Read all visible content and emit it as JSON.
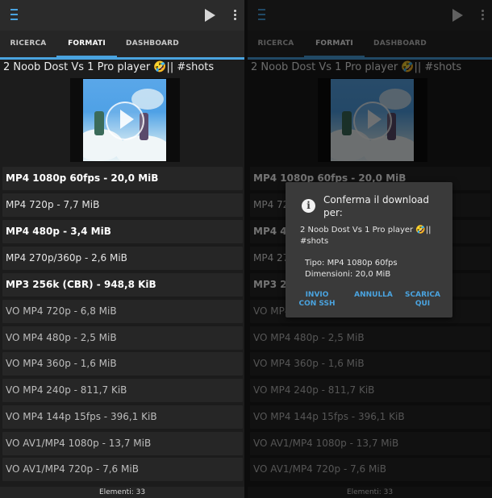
{
  "tabs": [
    "RICERCA",
    "FORMATI",
    "DASHBOARD"
  ],
  "video_title": "2 Noob Dost Vs 1 Pro player 🤣|| #shots",
  "formats": [
    {
      "label": "MP4 1080p 60fps - 20,0 MiB",
      "style": "bold"
    },
    {
      "label": "MP4 720p - 7,7 MiB",
      "style": "normal"
    },
    {
      "label": "MP4 480p - 3,4 MiB",
      "style": "bold"
    },
    {
      "label": "MP4 270p/360p - 2,6 MiB",
      "style": "normal"
    },
    {
      "label": "MP3 256k (CBR) - 948,8 KiB",
      "style": "bold"
    },
    {
      "label": "VO MP4 720p - 6,8 MiB",
      "style": "vo"
    },
    {
      "label": "VO MP4 480p - 2,5 MiB",
      "style": "vo"
    },
    {
      "label": "VO MP4 360p - 1,6 MiB",
      "style": "vo"
    },
    {
      "label": "VO MP4 240p - 811,7 KiB",
      "style": "vo"
    },
    {
      "label": "VO MP4 144p 15fps - 396,1 KiB",
      "style": "vo"
    },
    {
      "label": "VO AV1/MP4 1080p - 13,7 MiB",
      "style": "vo"
    },
    {
      "label": "VO AV1/MP4 720p - 7,6 MiB",
      "style": "vo"
    }
  ],
  "footer": "Elementi: 33",
  "dialog": {
    "title": "Conferma il download per:",
    "video": "2 Noob Dost Vs 1 Pro player 🤣|| #shots",
    "type": "Tipo: MP4 1080p 60fps",
    "size": "Dimensioni: 20,0 MiB",
    "buttons": [
      "INVIO CON SSH",
      "ANNULLA",
      "SCARICA QUI"
    ]
  },
  "colors": {
    "accent": "#4aa3df",
    "background": "#1c1c1c",
    "row": "#262626"
  }
}
